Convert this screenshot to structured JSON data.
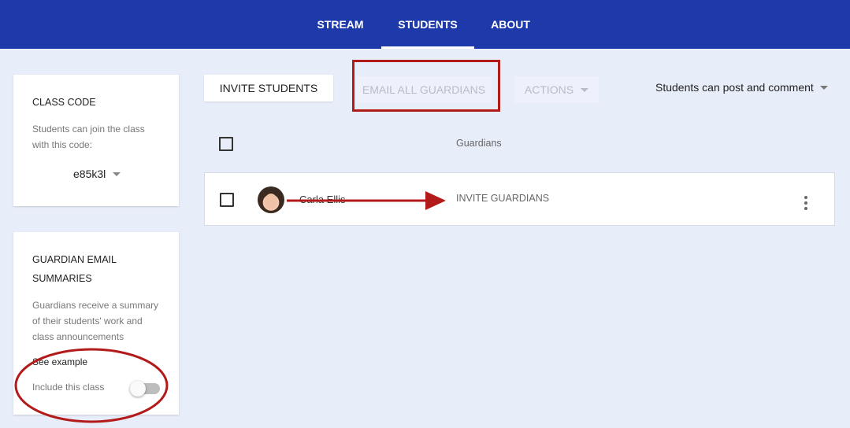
{
  "nav": {
    "tabs": [
      {
        "label": "STREAM"
      },
      {
        "label": "STUDENTS",
        "active": true
      },
      {
        "label": "ABOUT"
      }
    ]
  },
  "class_code_card": {
    "title": "CLASS CODE",
    "description": "Students can join the class with this code:",
    "code": "e85k3l"
  },
  "guardian_card": {
    "title": "GUARDIAN EMAIL SUMMARIES",
    "description": "Guardians receive a summary of their students' work and class announcements",
    "see_example": "See example",
    "include_label": "Include this class",
    "include_enabled": false
  },
  "toolbar": {
    "invite_students": "INVITE STUDENTS",
    "email_all_guardians": "EMAIL ALL GUARDIANS",
    "actions": "ACTIONS",
    "post_setting": "Students can post and comment"
  },
  "table": {
    "guardians_header": "Guardians",
    "rows": [
      {
        "name": "Carla Ellis",
        "guardian_action": "INVITE GUARDIANS"
      }
    ]
  },
  "annotation_color": "#b31b1b",
  "icons": [
    "caret-down-icon",
    "checkbox-icon",
    "more-vert-icon",
    "avatar",
    "toggle-switch"
  ]
}
